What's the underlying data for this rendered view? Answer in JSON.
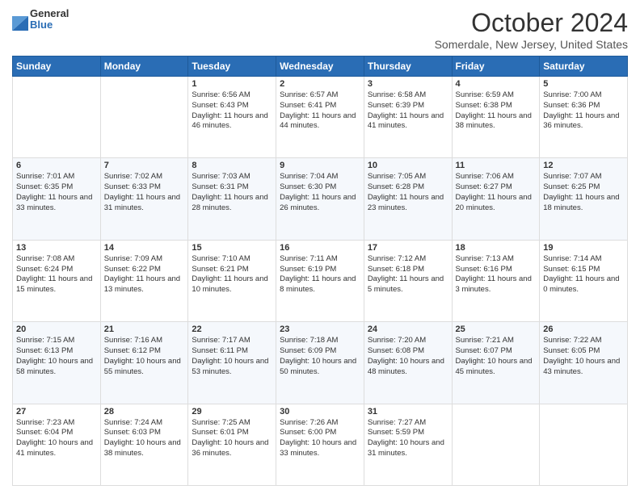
{
  "header": {
    "logo_general": "General",
    "logo_blue": "Blue",
    "month_title": "October 2024",
    "location": "Somerdale, New Jersey, United States"
  },
  "days_of_week": [
    "Sunday",
    "Monday",
    "Tuesday",
    "Wednesday",
    "Thursday",
    "Friday",
    "Saturday"
  ],
  "weeks": [
    [
      {
        "day": "",
        "sunrise": "",
        "sunset": "",
        "daylight": ""
      },
      {
        "day": "",
        "sunrise": "",
        "sunset": "",
        "daylight": ""
      },
      {
        "day": "1",
        "sunrise": "Sunrise: 6:56 AM",
        "sunset": "Sunset: 6:43 PM",
        "daylight": "Daylight: 11 hours and 46 minutes."
      },
      {
        "day": "2",
        "sunrise": "Sunrise: 6:57 AM",
        "sunset": "Sunset: 6:41 PM",
        "daylight": "Daylight: 11 hours and 44 minutes."
      },
      {
        "day": "3",
        "sunrise": "Sunrise: 6:58 AM",
        "sunset": "Sunset: 6:39 PM",
        "daylight": "Daylight: 11 hours and 41 minutes."
      },
      {
        "day": "4",
        "sunrise": "Sunrise: 6:59 AM",
        "sunset": "Sunset: 6:38 PM",
        "daylight": "Daylight: 11 hours and 38 minutes."
      },
      {
        "day": "5",
        "sunrise": "Sunrise: 7:00 AM",
        "sunset": "Sunset: 6:36 PM",
        "daylight": "Daylight: 11 hours and 36 minutes."
      }
    ],
    [
      {
        "day": "6",
        "sunrise": "Sunrise: 7:01 AM",
        "sunset": "Sunset: 6:35 PM",
        "daylight": "Daylight: 11 hours and 33 minutes."
      },
      {
        "day": "7",
        "sunrise": "Sunrise: 7:02 AM",
        "sunset": "Sunset: 6:33 PM",
        "daylight": "Daylight: 11 hours and 31 minutes."
      },
      {
        "day": "8",
        "sunrise": "Sunrise: 7:03 AM",
        "sunset": "Sunset: 6:31 PM",
        "daylight": "Daylight: 11 hours and 28 minutes."
      },
      {
        "day": "9",
        "sunrise": "Sunrise: 7:04 AM",
        "sunset": "Sunset: 6:30 PM",
        "daylight": "Daylight: 11 hours and 26 minutes."
      },
      {
        "day": "10",
        "sunrise": "Sunrise: 7:05 AM",
        "sunset": "Sunset: 6:28 PM",
        "daylight": "Daylight: 11 hours and 23 minutes."
      },
      {
        "day": "11",
        "sunrise": "Sunrise: 7:06 AM",
        "sunset": "Sunset: 6:27 PM",
        "daylight": "Daylight: 11 hours and 20 minutes."
      },
      {
        "day": "12",
        "sunrise": "Sunrise: 7:07 AM",
        "sunset": "Sunset: 6:25 PM",
        "daylight": "Daylight: 11 hours and 18 minutes."
      }
    ],
    [
      {
        "day": "13",
        "sunrise": "Sunrise: 7:08 AM",
        "sunset": "Sunset: 6:24 PM",
        "daylight": "Daylight: 11 hours and 15 minutes."
      },
      {
        "day": "14",
        "sunrise": "Sunrise: 7:09 AM",
        "sunset": "Sunset: 6:22 PM",
        "daylight": "Daylight: 11 hours and 13 minutes."
      },
      {
        "day": "15",
        "sunrise": "Sunrise: 7:10 AM",
        "sunset": "Sunset: 6:21 PM",
        "daylight": "Daylight: 11 hours and 10 minutes."
      },
      {
        "day": "16",
        "sunrise": "Sunrise: 7:11 AM",
        "sunset": "Sunset: 6:19 PM",
        "daylight": "Daylight: 11 hours and 8 minutes."
      },
      {
        "day": "17",
        "sunrise": "Sunrise: 7:12 AM",
        "sunset": "Sunset: 6:18 PM",
        "daylight": "Daylight: 11 hours and 5 minutes."
      },
      {
        "day": "18",
        "sunrise": "Sunrise: 7:13 AM",
        "sunset": "Sunset: 6:16 PM",
        "daylight": "Daylight: 11 hours and 3 minutes."
      },
      {
        "day": "19",
        "sunrise": "Sunrise: 7:14 AM",
        "sunset": "Sunset: 6:15 PM",
        "daylight": "Daylight: 11 hours and 0 minutes."
      }
    ],
    [
      {
        "day": "20",
        "sunrise": "Sunrise: 7:15 AM",
        "sunset": "Sunset: 6:13 PM",
        "daylight": "Daylight: 10 hours and 58 minutes."
      },
      {
        "day": "21",
        "sunrise": "Sunrise: 7:16 AM",
        "sunset": "Sunset: 6:12 PM",
        "daylight": "Daylight: 10 hours and 55 minutes."
      },
      {
        "day": "22",
        "sunrise": "Sunrise: 7:17 AM",
        "sunset": "Sunset: 6:11 PM",
        "daylight": "Daylight: 10 hours and 53 minutes."
      },
      {
        "day": "23",
        "sunrise": "Sunrise: 7:18 AM",
        "sunset": "Sunset: 6:09 PM",
        "daylight": "Daylight: 10 hours and 50 minutes."
      },
      {
        "day": "24",
        "sunrise": "Sunrise: 7:20 AM",
        "sunset": "Sunset: 6:08 PM",
        "daylight": "Daylight: 10 hours and 48 minutes."
      },
      {
        "day": "25",
        "sunrise": "Sunrise: 7:21 AM",
        "sunset": "Sunset: 6:07 PM",
        "daylight": "Daylight: 10 hours and 45 minutes."
      },
      {
        "day": "26",
        "sunrise": "Sunrise: 7:22 AM",
        "sunset": "Sunset: 6:05 PM",
        "daylight": "Daylight: 10 hours and 43 minutes."
      }
    ],
    [
      {
        "day": "27",
        "sunrise": "Sunrise: 7:23 AM",
        "sunset": "Sunset: 6:04 PM",
        "daylight": "Daylight: 10 hours and 41 minutes."
      },
      {
        "day": "28",
        "sunrise": "Sunrise: 7:24 AM",
        "sunset": "Sunset: 6:03 PM",
        "daylight": "Daylight: 10 hours and 38 minutes."
      },
      {
        "day": "29",
        "sunrise": "Sunrise: 7:25 AM",
        "sunset": "Sunset: 6:01 PM",
        "daylight": "Daylight: 10 hours and 36 minutes."
      },
      {
        "day": "30",
        "sunrise": "Sunrise: 7:26 AM",
        "sunset": "Sunset: 6:00 PM",
        "daylight": "Daylight: 10 hours and 33 minutes."
      },
      {
        "day": "31",
        "sunrise": "Sunrise: 7:27 AM",
        "sunset": "Sunset: 5:59 PM",
        "daylight": "Daylight: 10 hours and 31 minutes."
      },
      {
        "day": "",
        "sunrise": "",
        "sunset": "",
        "daylight": ""
      },
      {
        "day": "",
        "sunrise": "",
        "sunset": "",
        "daylight": ""
      }
    ]
  ]
}
